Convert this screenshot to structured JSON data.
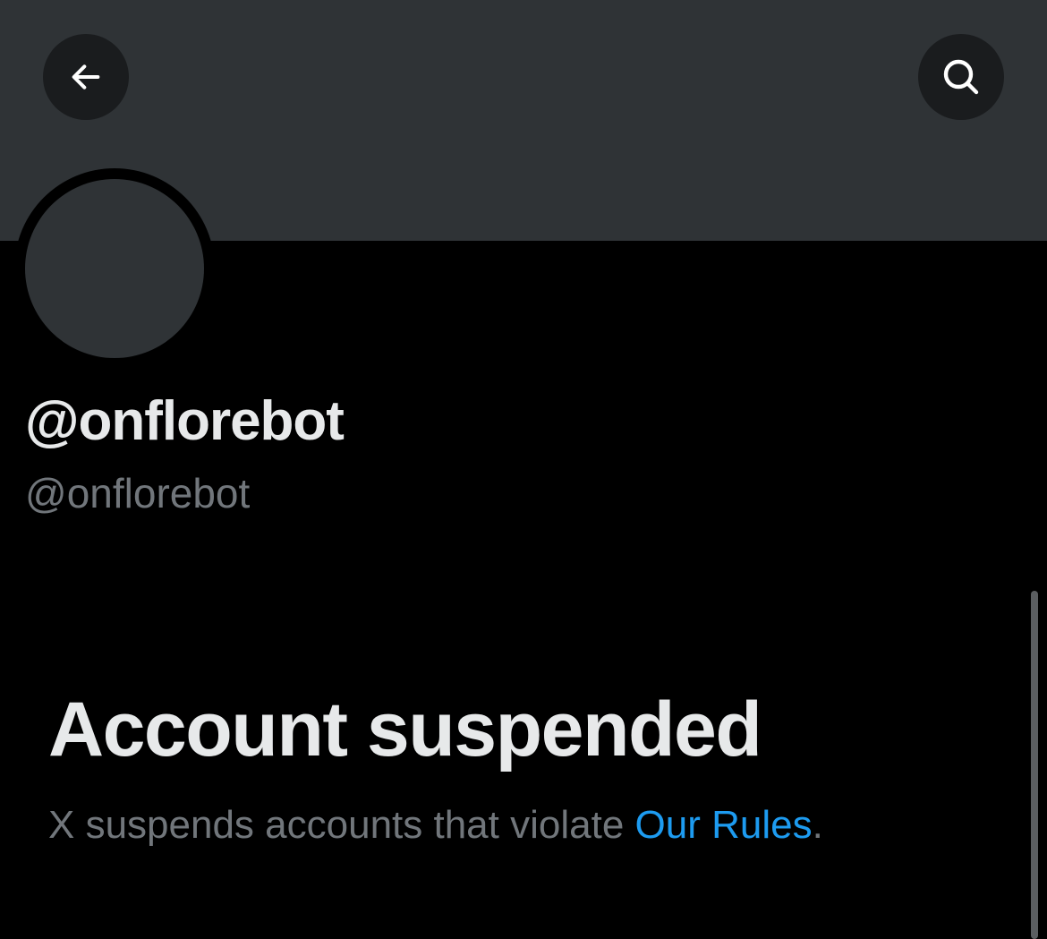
{
  "header": {
    "back_icon": "arrow-left-icon",
    "search_icon": "search-icon"
  },
  "profile": {
    "display_name": "@onflorebot",
    "handle": "@onflorebot"
  },
  "suspension": {
    "title": "Account suspended",
    "message_prefix": "X suspends accounts that violate ",
    "rules_link": "Our Rules",
    "message_suffix": "."
  },
  "colors": {
    "background": "#000000",
    "banner": "#2f3336",
    "primary_text": "#e7e9ea",
    "secondary_text": "#71767b",
    "link": "#1d9bf0"
  }
}
